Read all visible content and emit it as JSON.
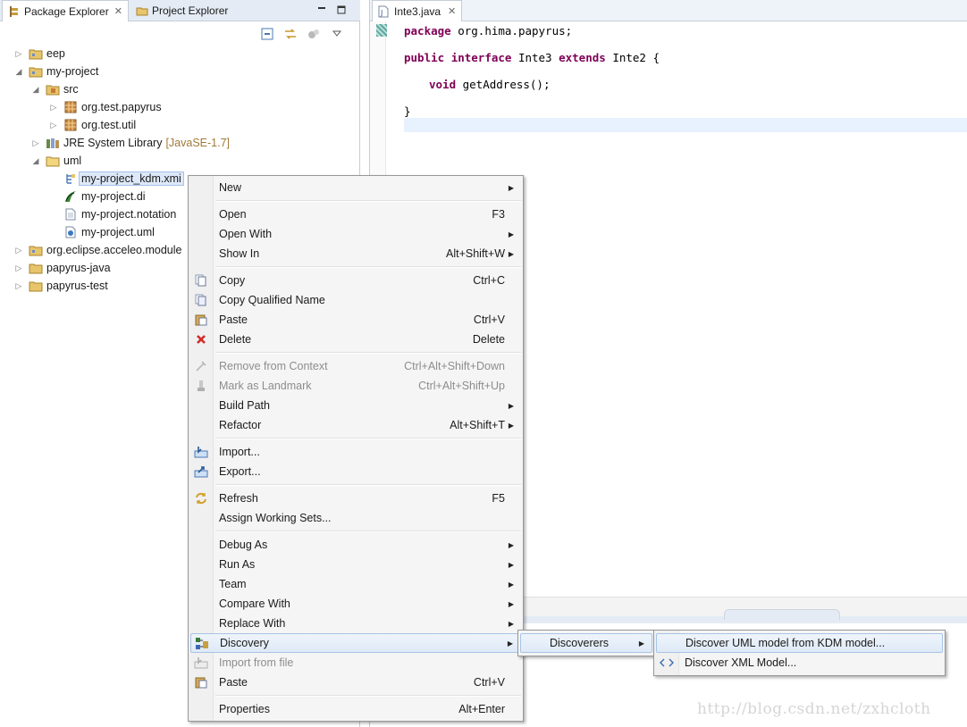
{
  "left_view": {
    "tabs": [
      {
        "label": "Package Explorer",
        "close": "✕"
      },
      {
        "label": "Project Explorer"
      }
    ],
    "tree": [
      {
        "label": "eep"
      },
      {
        "label": "my-project"
      },
      {
        "label": "src"
      },
      {
        "label": "org.test.papyrus"
      },
      {
        "label": "org.test.util"
      },
      {
        "label": "JRE System Library",
        "decoration": "[JavaSE-1.7]"
      },
      {
        "label": "uml"
      },
      {
        "label": "my-project_kdm.xmi"
      },
      {
        "label": "my-project.di"
      },
      {
        "label": "my-project.notation"
      },
      {
        "label": "my-project.uml"
      },
      {
        "label": "org.eclipse.acceleo.module"
      },
      {
        "label": "papyrus-java"
      },
      {
        "label": "papyrus-test"
      }
    ]
  },
  "editor": {
    "tab_label": "Inte3.java",
    "tab_close": "✕",
    "code": {
      "line1_kw": "package",
      "line1_rest": " org.hima.papyrus;",
      "line2_kw1": "public",
      "line2_kw2": "interface",
      "line2_mid": " Inte3 ",
      "line2_kw3": "extends",
      "line2_rest": " Inte2 {",
      "line3_kw": "void",
      "line3_rest": " getAddress();",
      "line4": "}"
    }
  },
  "context_menu": {
    "items": [
      {
        "label": "New",
        "submenu": true
      },
      {
        "label": "Open",
        "accel": "F3"
      },
      {
        "label": "Open With",
        "submenu": true
      },
      {
        "label": "Show In",
        "accel": "Alt+Shift+W",
        "submenu": true
      },
      {
        "label": "Copy",
        "accel": "Ctrl+C"
      },
      {
        "label": "Copy Qualified Name"
      },
      {
        "label": "Paste",
        "accel": "Ctrl+V"
      },
      {
        "label": "Delete",
        "accel": "Delete"
      },
      {
        "label": "Remove from Context",
        "accel": "Ctrl+Alt+Shift+Down",
        "disabled": true
      },
      {
        "label": "Mark as Landmark",
        "accel": "Ctrl+Alt+Shift+Up",
        "disabled": true
      },
      {
        "label": "Build Path",
        "submenu": true
      },
      {
        "label": "Refactor",
        "accel": "Alt+Shift+T",
        "submenu": true
      },
      {
        "label": "Import..."
      },
      {
        "label": "Export..."
      },
      {
        "label": "Refresh",
        "accel": "F5"
      },
      {
        "label": "Assign Working Sets..."
      },
      {
        "label": "Debug As",
        "submenu": true
      },
      {
        "label": "Run As",
        "submenu": true
      },
      {
        "label": "Team",
        "submenu": true
      },
      {
        "label": "Compare With",
        "submenu": true
      },
      {
        "label": "Replace With",
        "submenu": true
      },
      {
        "label": "Discovery",
        "submenu": true,
        "highlighted": true
      },
      {
        "label": "Import from file",
        "disabled": true
      },
      {
        "label": "Paste",
        "accel": "Ctrl+V"
      },
      {
        "label": "Properties",
        "accel": "Alt+Enter"
      }
    ]
  },
  "submenu_discovery": {
    "items": [
      {
        "label": "Discoverers",
        "submenu": true,
        "highlighted": true
      }
    ]
  },
  "submenu_discoverers": {
    "items": [
      {
        "label": "Discover UML model from KDM model...",
        "highlighted": true
      },
      {
        "label": "Discover XML Model..."
      }
    ]
  },
  "watermark": "http://blog.csdn.net/zxhcloth",
  "colors": {
    "keyword": "#7f0055",
    "selection": "#dde8f8",
    "menu_highlight_border": "#a8c4e6",
    "delete_icon": "#d42a2a"
  }
}
